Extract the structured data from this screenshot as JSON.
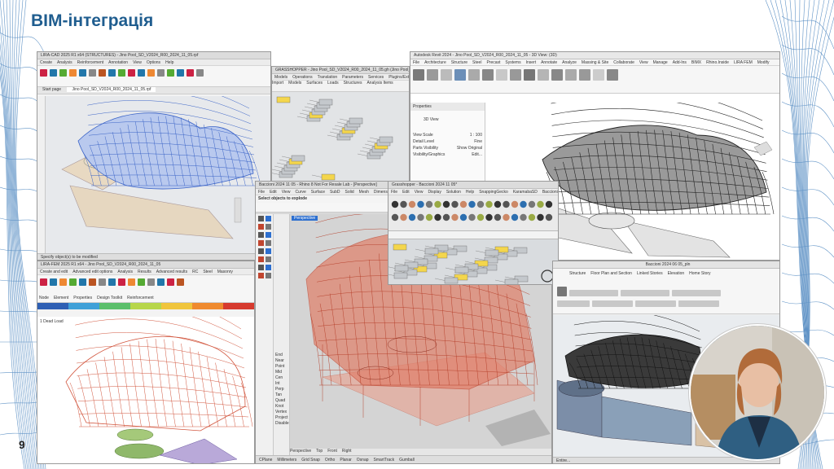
{
  "slide": {
    "title": "BIM-інтеграція",
    "page_number": "9"
  },
  "colors": {
    "title": "#1f5d8f",
    "mesh": "#2b6fb3",
    "revit_tab": "#1b4a7a",
    "structure_blue": "#3a63c7",
    "structure_red": "#d2563e"
  },
  "windows": {
    "lira_cad": {
      "title": "LIRA-CAD 2025 R1 x64 (STRUCTURES) - Jino Pool_SD_V2024_R00_2024_11_05.rpf",
      "menu": [
        "Create",
        "Analysis",
        "Reinforcement",
        "Annotation",
        "View",
        "Options",
        "Help"
      ],
      "tab": "Start page",
      "doc_tab": "Jino Pool_SD_V2024_R00_2024_11_05.rpf",
      "status": "Specify object(s) to be modified"
    },
    "grasshopper_top": {
      "title": "GRASSHOPPER - Jino Pool_SD_V2024_R00_2024_11_05.gh (Jino Pool_SD)",
      "menu": [
        "Models",
        "Operations",
        "Translation",
        "Parameters",
        "Services",
        "Plugins/Extensions"
      ],
      "labels": [
        "Import",
        "Models",
        "Surfaces",
        "Loads",
        "Structures",
        "Analysis Items"
      ]
    },
    "revit": {
      "title": "Autodesk Revit 2024 - Jino Pool_SD_V2024_R00_2024_11_05 - 3D View: (3D)",
      "menu": [
        "File",
        "Architecture",
        "Structure",
        "Steel",
        "Precast",
        "Systems",
        "Insert",
        "Annotate",
        "Analyze",
        "Massing & Site",
        "Collaborate",
        "View",
        "Manage",
        "Add-Ins",
        "BIMX",
        "Rhino.Inside",
        "LIRA FEM",
        "Modify"
      ],
      "panel": "Properties",
      "view_type": "3D View",
      "props": [
        "View Scale",
        "Detail Level",
        "Parts Visibility",
        "Visibility/Graphics"
      ],
      "prop_values": [
        "1 : 100",
        "Fine",
        "Show Original",
        "Edit..."
      ]
    },
    "lira_fem": {
      "title": "LIRA-FEM 2025 R1 x64 - Jino Pool_SD_V2024_R00_2024_11_05",
      "menu": [
        "Create and edit",
        "Advanced edit options",
        "Analysis",
        "Results",
        "Advanced results",
        "RC",
        "Steel",
        "Masonry"
      ],
      "labels": [
        "Node",
        "Element",
        "Properties",
        "Design Toolkit",
        "Reinforcement"
      ],
      "load_label": "1 Dead Load"
    },
    "rhino": {
      "title": "Baccioni 2024 11 05 - Rhino 8 Not For Resale Lab - [Perspective]",
      "menu": [
        "File",
        "Edit",
        "View",
        "Curve",
        "Surface",
        "SubD",
        "Solid",
        "Mesh",
        "Dimension",
        "Transform",
        "Tools",
        "Analyze",
        "Render",
        "Panels",
        "Help"
      ],
      "prompt": "Select objects to explode",
      "viewport_label": "Perspective",
      "side_items": [
        "End",
        "Near",
        "Point",
        "Mid",
        "Cen",
        "Int",
        "Perp",
        "Tan",
        "Quad",
        "Knot",
        "Vertex",
        "Project",
        "Disable"
      ],
      "view_tabs": [
        "Perspective",
        "Top",
        "Front",
        "Right"
      ],
      "status": [
        "CPlane",
        "Millimeters",
        "Grid Snap",
        "Ortho",
        "Planar",
        "Osnap",
        "SmartTrack",
        "Gumball"
      ]
    },
    "grasshopper_main": {
      "title": "Grasshopper - Baccioni 2024 11 05*",
      "menu": [
        "File",
        "Edit",
        "View",
        "Display",
        "Solution",
        "Help",
        "SnappingGecko",
        "KaramabaSD",
        "Baccioni 2024-11-05"
      ]
    },
    "archicad": {
      "title": "Baccioni 2024 06 05_pln",
      "labels": [
        "Structure",
        "Floor Plan and Section",
        "Linked Stories",
        "Elevation",
        "Home Story"
      ],
      "status": "Entire..."
    }
  }
}
